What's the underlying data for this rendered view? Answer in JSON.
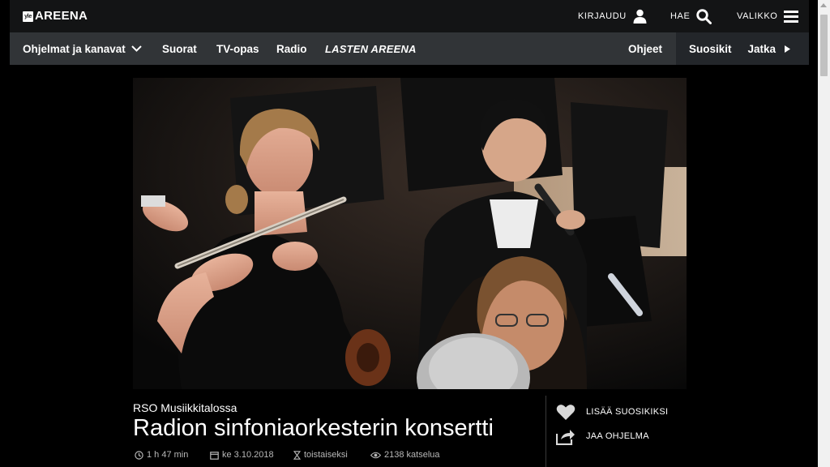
{
  "header": {
    "logo_badge": "yle",
    "logo_text": "AREENA",
    "login_label": "KIRJAUDU",
    "login_icon": "user-icon",
    "search_label": "HAE",
    "search_icon": "search-icon",
    "menu_label": "VALIKKO",
    "menu_icon": "hamburger-icon"
  },
  "nav": {
    "programs_label": "Ohjelmat ja kanavat",
    "programs_icon": "chevron-down-icon",
    "live_label": "Suorat",
    "tvguide_label": "TV-opas",
    "radio_label": "Radio",
    "kids_label": "LASTEN AREENA",
    "help_label": "Ohjeet",
    "favorites_label": "Suosikit",
    "continue_label": "Jatka",
    "continue_icon": "play-arrow-icon"
  },
  "program": {
    "series": "RSO Musiikkitalossa",
    "title": "Radion sinfoniaorkesterin konsertti",
    "duration": "1 h 47 min",
    "date": "ke 3.10.2018",
    "availability": "toistaiseksi",
    "views": "2138 katselua"
  },
  "actions": {
    "favorite_label": "LISÄÄ SUOSIKIKSI",
    "favorite_icon": "heart-icon",
    "share_label": "JAA OHJELMA",
    "share_icon": "share-icon"
  },
  "colors": {
    "header_bg": "#131415",
    "nav_bg": "#313437",
    "nav_dark_bg": "#23262a",
    "meta_text": "#b8b8b8"
  }
}
